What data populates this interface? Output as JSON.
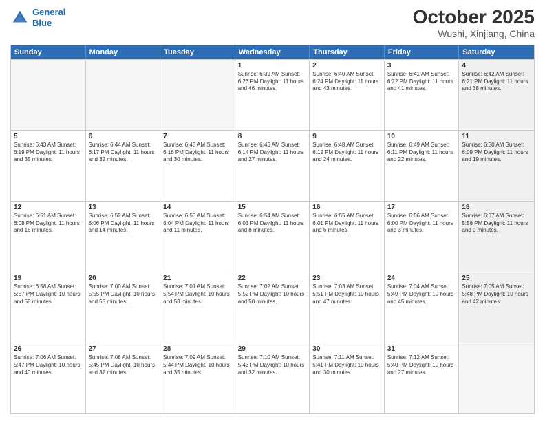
{
  "header": {
    "logo_line1": "General",
    "logo_line2": "Blue",
    "title": "October 2025",
    "subtitle": "Wushi, Xinjiang, China"
  },
  "weekdays": [
    "Sunday",
    "Monday",
    "Tuesday",
    "Wednesday",
    "Thursday",
    "Friday",
    "Saturday"
  ],
  "rows": [
    [
      {
        "day": "",
        "info": "",
        "empty": true
      },
      {
        "day": "",
        "info": "",
        "empty": true
      },
      {
        "day": "",
        "info": "",
        "empty": true
      },
      {
        "day": "1",
        "info": "Sunrise: 6:39 AM\nSunset: 6:26 PM\nDaylight: 11 hours\nand 46 minutes."
      },
      {
        "day": "2",
        "info": "Sunrise: 6:40 AM\nSunset: 6:24 PM\nDaylight: 11 hours\nand 43 minutes."
      },
      {
        "day": "3",
        "info": "Sunrise: 6:41 AM\nSunset: 6:22 PM\nDaylight: 11 hours\nand 41 minutes."
      },
      {
        "day": "4",
        "info": "Sunrise: 6:42 AM\nSunset: 6:21 PM\nDaylight: 11 hours\nand 38 minutes.",
        "shaded": true
      }
    ],
    [
      {
        "day": "5",
        "info": "Sunrise: 6:43 AM\nSunset: 6:19 PM\nDaylight: 11 hours\nand 35 minutes."
      },
      {
        "day": "6",
        "info": "Sunrise: 6:44 AM\nSunset: 6:17 PM\nDaylight: 11 hours\nand 32 minutes."
      },
      {
        "day": "7",
        "info": "Sunrise: 6:45 AM\nSunset: 6:16 PM\nDaylight: 11 hours\nand 30 minutes."
      },
      {
        "day": "8",
        "info": "Sunrise: 6:46 AM\nSunset: 6:14 PM\nDaylight: 11 hours\nand 27 minutes."
      },
      {
        "day": "9",
        "info": "Sunrise: 6:48 AM\nSunset: 6:12 PM\nDaylight: 11 hours\nand 24 minutes."
      },
      {
        "day": "10",
        "info": "Sunrise: 6:49 AM\nSunset: 6:11 PM\nDaylight: 11 hours\nand 22 minutes."
      },
      {
        "day": "11",
        "info": "Sunrise: 6:50 AM\nSunset: 6:09 PM\nDaylight: 11 hours\nand 19 minutes.",
        "shaded": true
      }
    ],
    [
      {
        "day": "12",
        "info": "Sunrise: 6:51 AM\nSunset: 6:08 PM\nDaylight: 11 hours\nand 16 minutes."
      },
      {
        "day": "13",
        "info": "Sunrise: 6:52 AM\nSunset: 6:06 PM\nDaylight: 11 hours\nand 14 minutes."
      },
      {
        "day": "14",
        "info": "Sunrise: 6:53 AM\nSunset: 6:04 PM\nDaylight: 11 hours\nand 11 minutes."
      },
      {
        "day": "15",
        "info": "Sunrise: 6:54 AM\nSunset: 6:03 PM\nDaylight: 11 hours\nand 8 minutes."
      },
      {
        "day": "16",
        "info": "Sunrise: 6:55 AM\nSunset: 6:01 PM\nDaylight: 11 hours\nand 6 minutes."
      },
      {
        "day": "17",
        "info": "Sunrise: 6:56 AM\nSunset: 6:00 PM\nDaylight: 11 hours\nand 3 minutes."
      },
      {
        "day": "18",
        "info": "Sunrise: 6:57 AM\nSunset: 5:58 PM\nDaylight: 11 hours\nand 0 minutes.",
        "shaded": true
      }
    ],
    [
      {
        "day": "19",
        "info": "Sunrise: 6:58 AM\nSunset: 5:57 PM\nDaylight: 10 hours\nand 58 minutes."
      },
      {
        "day": "20",
        "info": "Sunrise: 7:00 AM\nSunset: 5:55 PM\nDaylight: 10 hours\nand 55 minutes."
      },
      {
        "day": "21",
        "info": "Sunrise: 7:01 AM\nSunset: 5:54 PM\nDaylight: 10 hours\nand 53 minutes."
      },
      {
        "day": "22",
        "info": "Sunrise: 7:02 AM\nSunset: 5:52 PM\nDaylight: 10 hours\nand 50 minutes."
      },
      {
        "day": "23",
        "info": "Sunrise: 7:03 AM\nSunset: 5:51 PM\nDaylight: 10 hours\nand 47 minutes."
      },
      {
        "day": "24",
        "info": "Sunrise: 7:04 AM\nSunset: 5:49 PM\nDaylight: 10 hours\nand 45 minutes."
      },
      {
        "day": "25",
        "info": "Sunrise: 7:05 AM\nSunset: 5:48 PM\nDaylight: 10 hours\nand 42 minutes.",
        "shaded": true
      }
    ],
    [
      {
        "day": "26",
        "info": "Sunrise: 7:06 AM\nSunset: 5:47 PM\nDaylight: 10 hours\nand 40 minutes."
      },
      {
        "day": "27",
        "info": "Sunrise: 7:08 AM\nSunset: 5:45 PM\nDaylight: 10 hours\nand 37 minutes."
      },
      {
        "day": "28",
        "info": "Sunrise: 7:09 AM\nSunset: 5:44 PM\nDaylight: 10 hours\nand 35 minutes."
      },
      {
        "day": "29",
        "info": "Sunrise: 7:10 AM\nSunset: 5:43 PM\nDaylight: 10 hours\nand 32 minutes."
      },
      {
        "day": "30",
        "info": "Sunrise: 7:11 AM\nSunset: 5:41 PM\nDaylight: 10 hours\nand 30 minutes."
      },
      {
        "day": "31",
        "info": "Sunrise: 7:12 AM\nSunset: 5:40 PM\nDaylight: 10 hours\nand 27 minutes."
      },
      {
        "day": "",
        "info": "",
        "empty": true,
        "shaded": true
      }
    ]
  ]
}
